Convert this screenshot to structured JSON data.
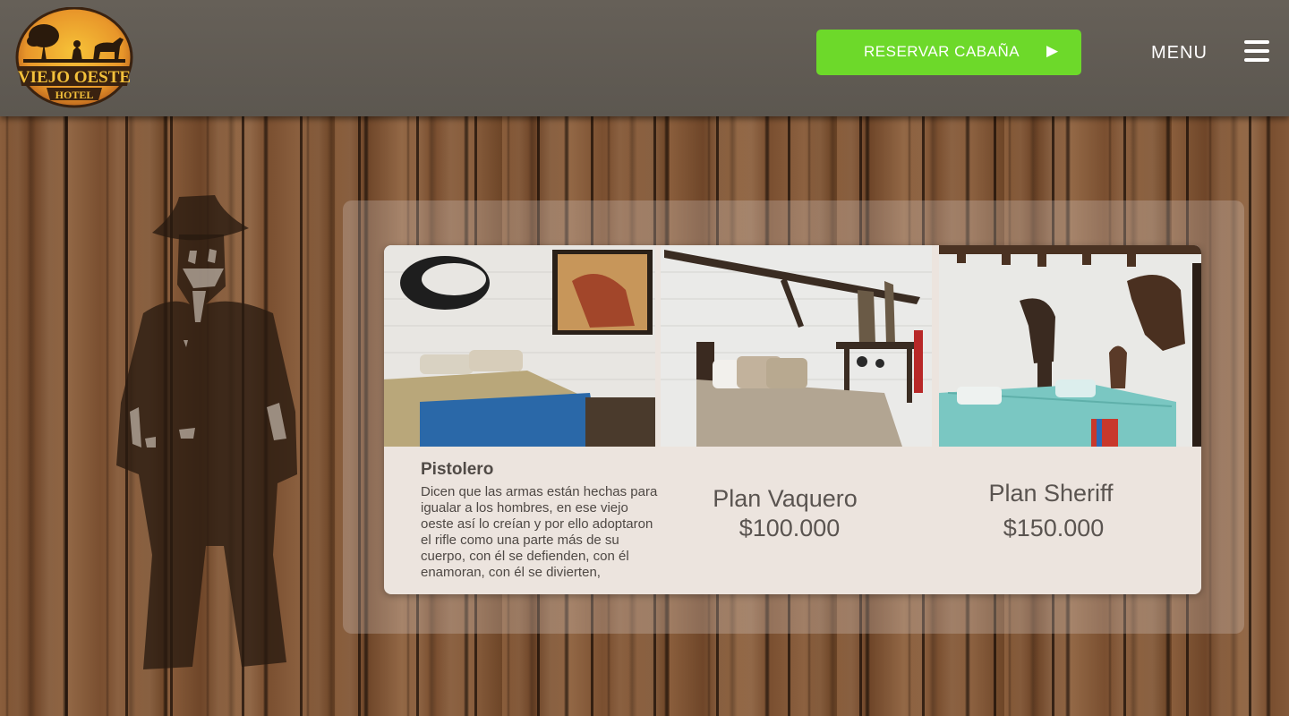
{
  "logo": {
    "line1": "VIEJO OESTE",
    "line2": "HOTEL"
  },
  "header": {
    "reserve_label": "RESERVAR CABAÑA",
    "reserve_arrow": "▶",
    "menu_label": "MENU",
    "menu_icon": "hamburger-icon"
  },
  "plans": [
    {
      "title": "Pistolero",
      "description": "Dicen que las armas están hechas para igualar a los hombres, en ese viejo oeste así lo creían y por ello adoptaron el rifle como una parte más de su cuerpo, con él se defienden, con él enamoran, con él se divierten,"
    },
    {
      "name": "Plan Vaquero",
      "price": "$100.000"
    },
    {
      "name": "Plan Sheriff",
      "price": "$150.000"
    }
  ],
  "colors": {
    "accent": "#6dd92a",
    "header_bg": "#615c55",
    "card_bg": "#ece4de"
  }
}
